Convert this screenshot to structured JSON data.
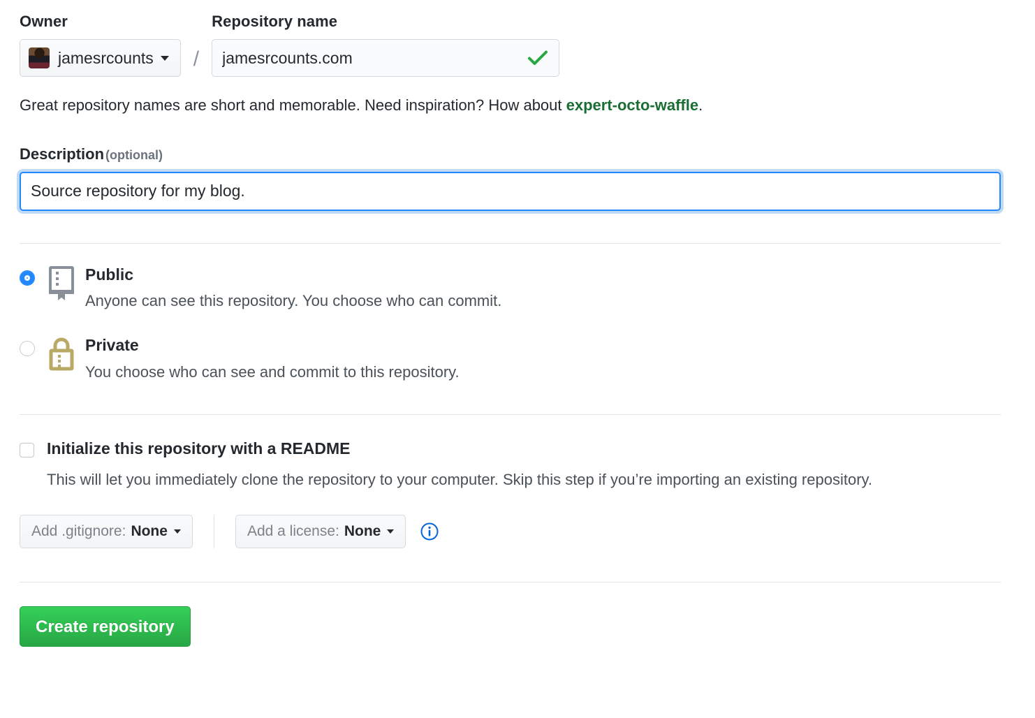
{
  "owner": {
    "label": "Owner",
    "name": "jamesrcounts",
    "caret_icon": "chevron-down-icon",
    "avatar_icon": "user-avatar"
  },
  "separator": "/",
  "repository": {
    "label": "Repository name",
    "value": "jamesrcounts.com",
    "placeholder": "",
    "validity_icon": "check-icon",
    "validity_color": "#28a745"
  },
  "hint": {
    "prefix": "Great repository names are short and memorable. Need inspiration? How about ",
    "suggestion": "expert-octo-waffle",
    "suffix": ".",
    "suggestion_color": "#1b6e33"
  },
  "description": {
    "label": "Description",
    "optional": "(optional)",
    "value": "Source repository for my blog.",
    "placeholder": "",
    "focus_color": "#2188ff"
  },
  "visibility": {
    "options": [
      {
        "id": "public",
        "title": "Public",
        "description": "Anyone can see this repository. You choose who can commit.",
        "selected": true,
        "icon": "repo-book-icon",
        "icon_color": "#8a9099"
      },
      {
        "id": "private",
        "title": "Private",
        "description": "You choose who can see and commit to this repository.",
        "selected": false,
        "icon": "lock-icon",
        "icon_color": "#b8a965"
      }
    ],
    "radio_accent": "#2188ff"
  },
  "readme": {
    "title": "Initialize this repository with a README",
    "description": "This will let you immediately clone the repository to your computer. Skip this step if you’re importing an existing repository.",
    "checked": false
  },
  "pickers": {
    "gitignore": {
      "prefix": "Add .gitignore:",
      "value": "None",
      "caret_icon": "chevron-down-icon"
    },
    "license": {
      "prefix": "Add a license:",
      "value": "None",
      "caret_icon": "chevron-down-icon"
    },
    "info_icon": "info-circle-icon",
    "info_color": "#0366d6"
  },
  "submit": {
    "label": "Create repository",
    "color": "#28a745"
  }
}
